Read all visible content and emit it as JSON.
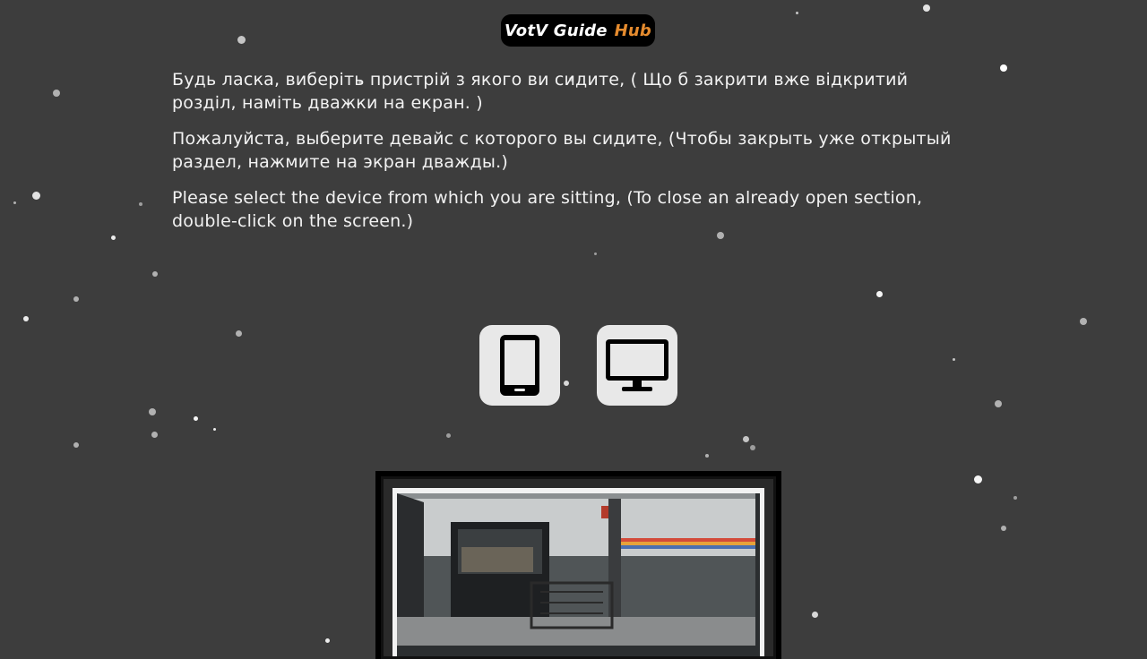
{
  "header": {
    "logo_main": "VotV Guide",
    "logo_accent": "Hub",
    "accent_color": "#e58b2e"
  },
  "intro": {
    "uk": "Будь ласка, виберіть пристрій з якого ви сидите, ( Що б закрити вже відкритий розділ, наміть дважки на екран. )",
    "ru": "Пожалуйста, выберите девайс с которого вы сидите, (Чтобы закрыть уже открытый раздел, нажмите на экран дважды.)",
    "en": "Please select the device from which you are sitting, (To close an already open section, double-click on the screen.)"
  },
  "devices": [
    {
      "icon": "smartphone-icon"
    },
    {
      "icon": "desktop-monitor-icon"
    }
  ],
  "colors": {
    "background": "#3d3d3d",
    "text": "#f2f2f2",
    "button_bg": "#e8e8e8"
  }
}
